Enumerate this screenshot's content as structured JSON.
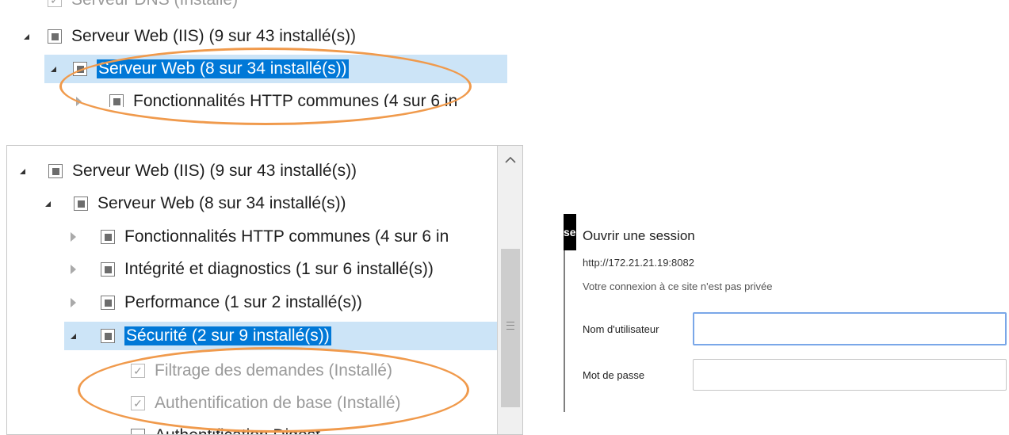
{
  "top_panel": {
    "dns_row": "Serveur DNS (Installé)",
    "iis_row": "Serveur Web (IIS) (9 sur 43 installé(s))",
    "web_row": "Serveur Web (8 sur 34 installé(s))",
    "http_row": "Fonctionnalités HTTP communes (4 sur 6 in"
  },
  "main_panel": {
    "items": [
      {
        "label": "Serveur Web (IIS) (9 sur 43 installé(s))"
      },
      {
        "label": "Serveur Web (8 sur 34 installé(s))"
      },
      {
        "label": "Fonctionnalités HTTP communes (4 sur 6 in"
      },
      {
        "label": "Intégrité et diagnostics (1 sur 6 installé(s))"
      },
      {
        "label": "Performance (1 sur 2 installé(s))"
      },
      {
        "label": "Sécurité (2 sur 9 installé(s))"
      },
      {
        "label": "Filtrage des demandes (Installé)"
      },
      {
        "label": "Authentification de base (Installé)"
      },
      {
        "label": "Authentification Digest"
      }
    ]
  },
  "login": {
    "tab_fragment": "se",
    "title": "Ouvrir une session",
    "url": "http://172.21.21.19:8082",
    "warning": "Votre connexion à ce site n'est pas privée",
    "username_label": "Nom d'utilisateur",
    "password_label": "Mot de passe",
    "username_value": "",
    "password_value": ""
  },
  "colors": {
    "highlight": "#0078d7",
    "selection_row": "#cce4f7",
    "annotation_oval": "#f09a4c"
  }
}
